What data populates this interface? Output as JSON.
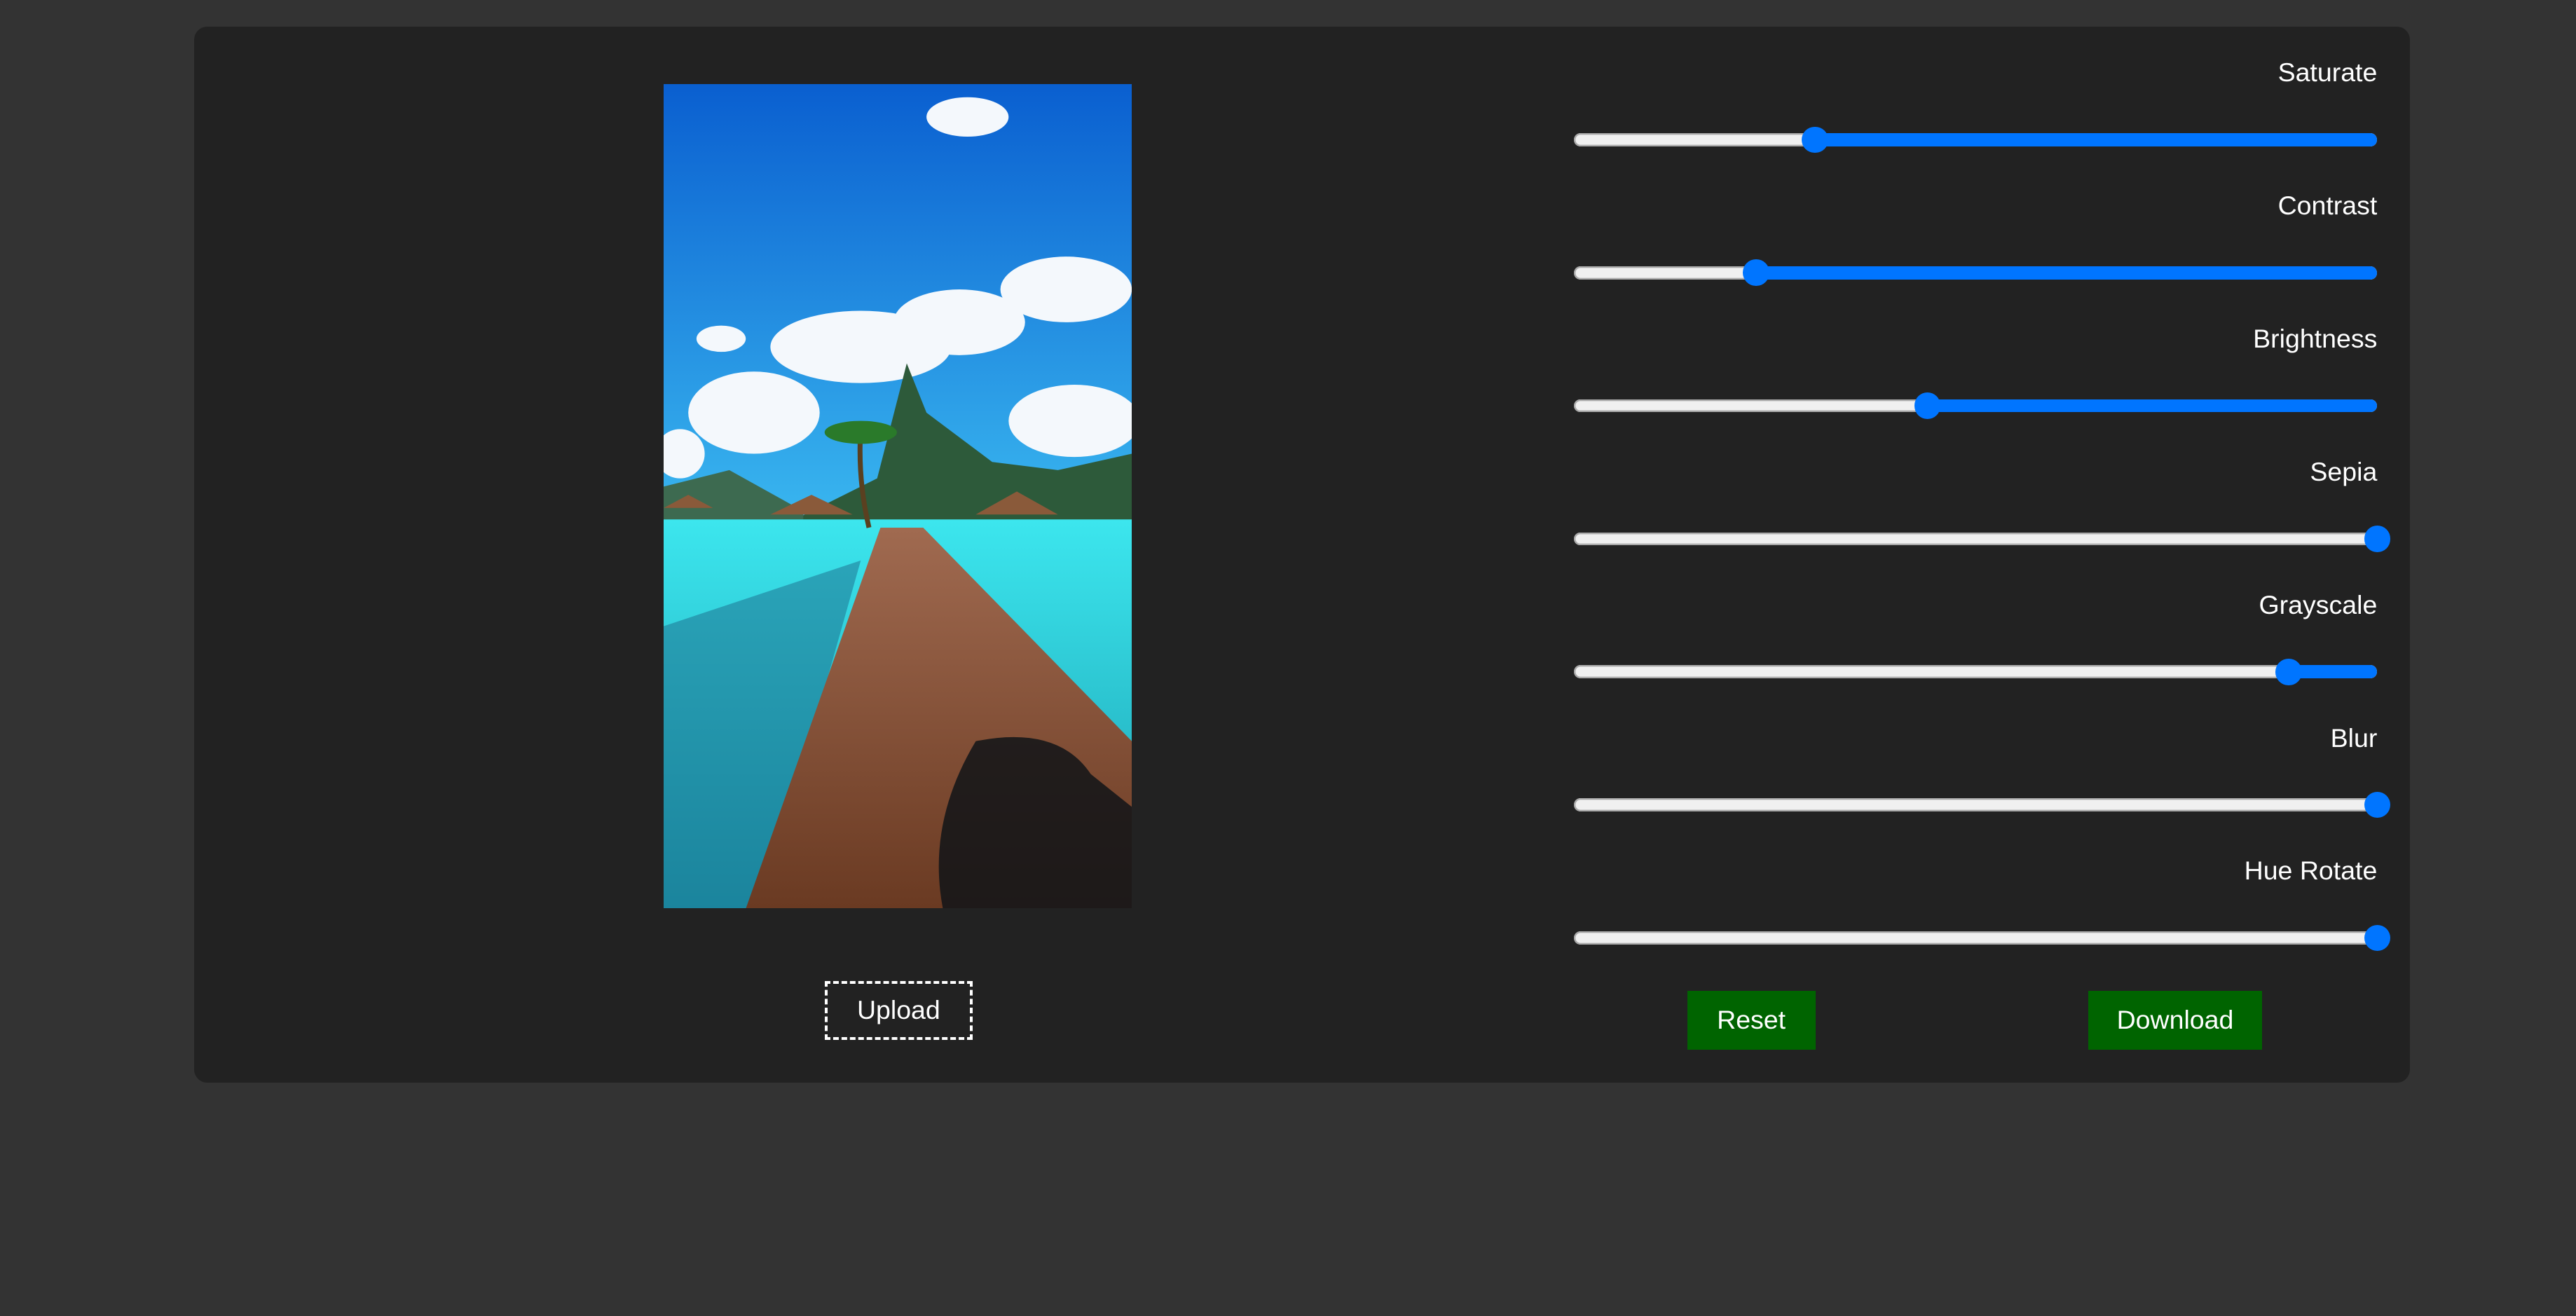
{
  "image": {
    "alt_icon": "photo-preview"
  },
  "upload_label": "Upload",
  "sliders": [
    {
      "label": "Saturate",
      "value_fraction": 0.3
    },
    {
      "label": "Contrast",
      "value_fraction": 0.227
    },
    {
      "label": "Brightness",
      "value_fraction": 0.44
    },
    {
      "label": "Sepia",
      "value_fraction": 1.0
    },
    {
      "label": "Grayscale",
      "value_fraction": 0.89
    },
    {
      "label": "Blur",
      "value_fraction": 1.0
    },
    {
      "label": "Hue Rotate",
      "value_fraction": 1.0
    }
  ],
  "buttons": {
    "reset": "Reset",
    "download": "Download"
  },
  "colors": {
    "accent": "#0075ff",
    "button": "#006400",
    "card": "#222222",
    "page": "#333333"
  }
}
